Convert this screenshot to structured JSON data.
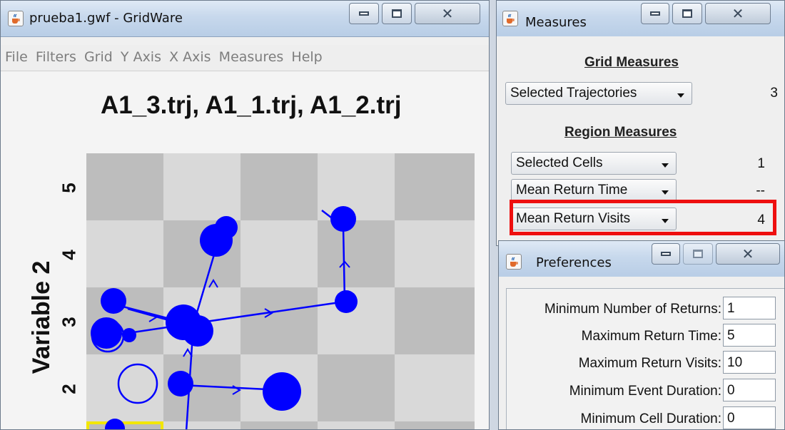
{
  "gridware": {
    "title": "prueba1.gwf - GridWare",
    "menu": [
      "File",
      "Filters",
      "Grid",
      "Y Axis",
      "X Axis",
      "Measures",
      "Help"
    ],
    "plot_title": "A1_3.trj, A1_1.trj, A1_2.trj",
    "y_axis_label": "Variable 2",
    "y_ticks": [
      "5",
      "4",
      "3",
      "2"
    ]
  },
  "measures": {
    "title": "Measures",
    "grid_heading": "Grid Measures",
    "grid_rows": [
      {
        "label": "Selected Trajectories",
        "value": "3"
      }
    ],
    "region_heading": "Region Measures",
    "region_rows": [
      {
        "label": "Selected Cells",
        "value": "1"
      },
      {
        "label": "Mean Return Time",
        "value": "--"
      },
      {
        "label": "Mean Return Visits",
        "value": "4"
      }
    ]
  },
  "preferences": {
    "title": "Preferences",
    "fields": [
      {
        "label": "Minimum Number of Returns:",
        "value": "1"
      },
      {
        "label": "Maximum Return Time:",
        "value": "5"
      },
      {
        "label": "Maximum Return Visits:",
        "value": "10"
      },
      {
        "label": "Minimum Event Duration:",
        "value": "0"
      },
      {
        "label": "Minimum Cell Duration:",
        "value": "0"
      }
    ]
  },
  "colors": {
    "trajectory": "#0000ff",
    "highlight_box": "#ee0f0f",
    "selected_cell": "#f2e600",
    "grid_light": "#d9d9d9",
    "grid_dark": "#bdbdbd"
  },
  "icons": {
    "app": "java-cup-icon",
    "minimize": "minimize-icon",
    "maximize": "maximize-icon",
    "close": "close-icon"
  }
}
